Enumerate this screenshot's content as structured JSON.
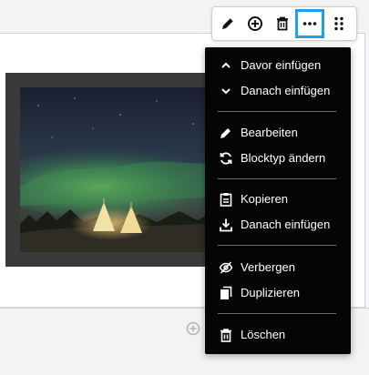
{
  "toolbar": {
    "buttons": [
      {
        "name": "pencil-icon",
        "action": "edit"
      },
      {
        "name": "plus-circle-icon",
        "action": "add"
      },
      {
        "name": "trash-icon",
        "action": "delete"
      },
      {
        "name": "more-horizontal-icon",
        "action": "more",
        "active": true
      },
      {
        "name": "drag-handle-icon",
        "action": "drag"
      }
    ],
    "active_color": "#1aa3e8"
  },
  "image": {
    "description_icon": "landscape-image",
    "frame_color": "#3a3a3a"
  },
  "menu": {
    "groups": [
      [
        {
          "icon": "chevron-up-icon",
          "label": "Davor einfügen"
        },
        {
          "icon": "chevron-down-icon",
          "label": "Danach einfügen"
        }
      ],
      [
        {
          "icon": "pencil-icon",
          "label": "Bearbeiten"
        },
        {
          "icon": "refresh-icon",
          "label": "Blocktyp ändern"
        }
      ],
      [
        {
          "icon": "clipboard-icon",
          "label": "Kopieren"
        },
        {
          "icon": "download-icon",
          "label": "Danach einfügen"
        }
      ],
      [
        {
          "icon": "eye-off-icon",
          "label": "Verbergen"
        },
        {
          "icon": "copy-icon",
          "label": "Duplizieren"
        }
      ],
      [
        {
          "icon": "trash-icon",
          "label": "Löschen"
        }
      ]
    ],
    "background": "#050505"
  }
}
